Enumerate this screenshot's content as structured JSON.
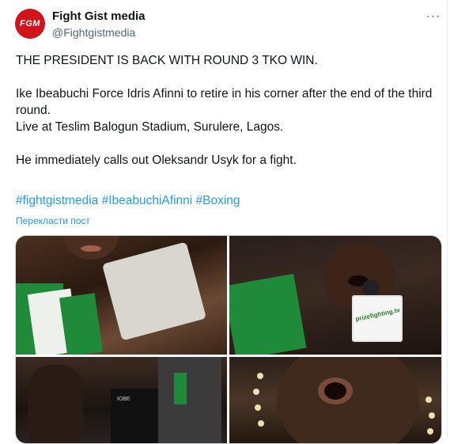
{
  "tweet": {
    "avatar_text": "FGM",
    "display_name": "Fight Gist media",
    "handle": "@Fightgistmedia",
    "more_label": "···",
    "lines": [
      "THE PRESIDENT IS BACK WITH ROUND 3 TKO WIN.",
      "Ike Ibeabuchi Force Idris Afinni to retire in his corner after the end of the third round.",
      "Live at Teslim Balogun Stadium, Surulere, Lagos.",
      "He immediately calls out Oleksandr Usyk for a fight."
    ],
    "hashtags": [
      "#fightgistmedia",
      "#IbeabuchiAfinni",
      "#Boxing"
    ],
    "translate_label": "Перекласти пост",
    "mic_label": "prizefighting.tv",
    "trunks_label": "IOBE"
  },
  "colors": {
    "link": "#1d9bf0",
    "text": "#0f1419",
    "secondary": "#536471",
    "avatar_bg": "#d0141b"
  },
  "icons": {
    "more": "more-horizontal-icon"
  },
  "media": {
    "photo_count": 4
  }
}
